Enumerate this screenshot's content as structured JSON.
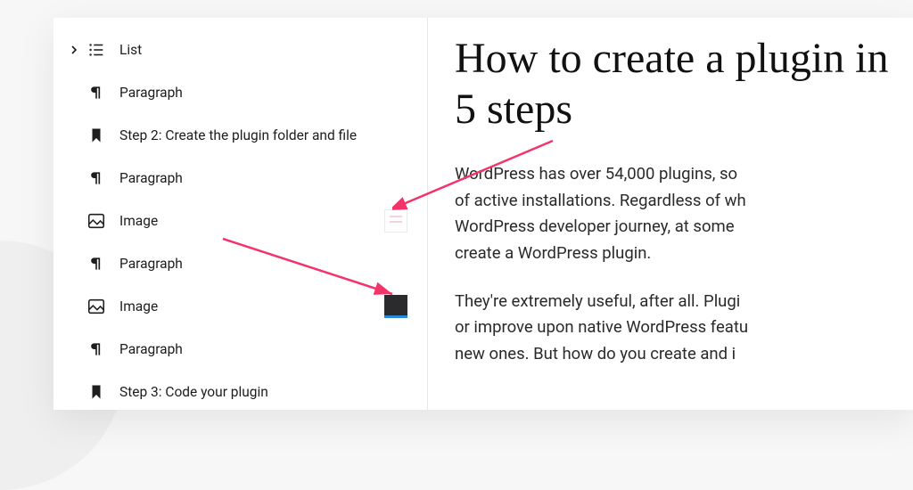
{
  "sidebar": {
    "items": [
      {
        "type": "List",
        "icon": "list-icon",
        "hasChevron": true
      },
      {
        "type": "Paragraph",
        "icon": "paragraph-icon"
      },
      {
        "type": "Step 2: Create the plugin folder and file",
        "icon": "heading-icon"
      },
      {
        "type": "Paragraph",
        "icon": "paragraph-icon"
      },
      {
        "type": "Image",
        "icon": "image-icon",
        "thumb": "light"
      },
      {
        "type": "Paragraph",
        "icon": "paragraph-icon"
      },
      {
        "type": "Image",
        "icon": "image-icon",
        "thumb": "dark"
      },
      {
        "type": "Paragraph",
        "icon": "paragraph-icon"
      },
      {
        "type": "Step 3: Code your plugin",
        "icon": "heading-icon"
      }
    ]
  },
  "content": {
    "title": "How to create a plugin in 5 steps",
    "p1": "WordPress has over 54,000 plugins, so",
    "p2": "of active installations. Regardless of wh",
    "p3": "WordPress developer journey, at some",
    "p4": "create a WordPress plugin.",
    "p5": "They're extremely useful, after all. Plugi",
    "p6": "or improve upon native WordPress featu",
    "p7": "new ones. But how do you create and i"
  },
  "arrows": {
    "color": "#F3346B"
  }
}
